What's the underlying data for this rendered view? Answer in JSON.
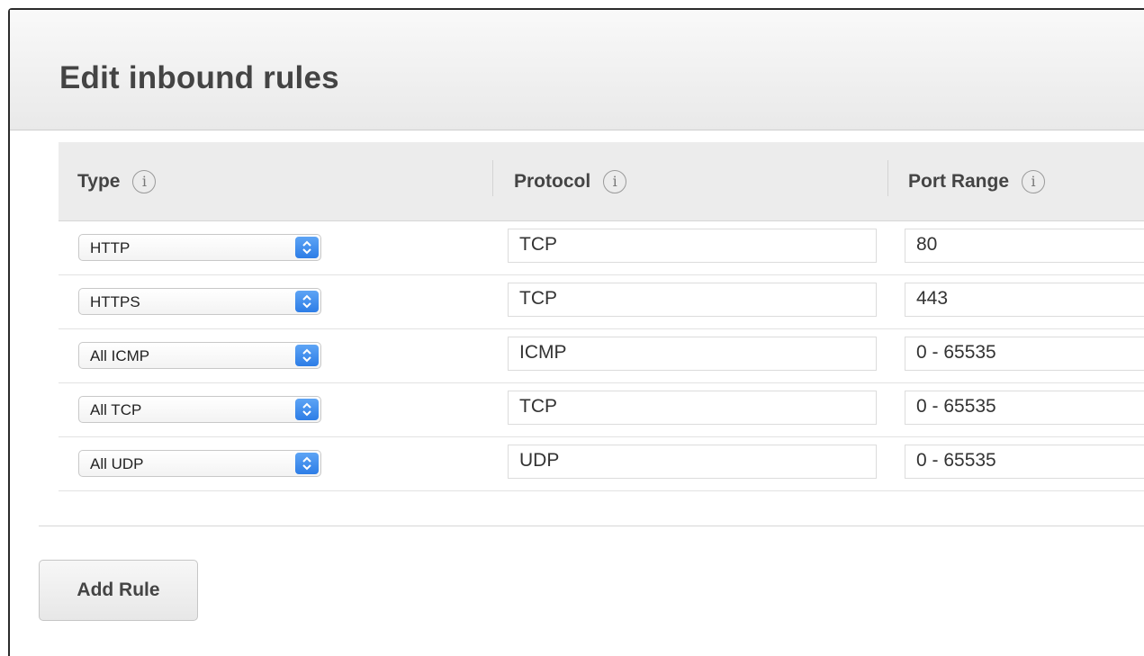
{
  "dialog": {
    "title": "Edit inbound rules",
    "add_rule_label": "Add Rule"
  },
  "table": {
    "columns": [
      {
        "label": "Type",
        "info_icon": "info-icon"
      },
      {
        "label": "Protocol",
        "info_icon": "info-icon"
      },
      {
        "label": "Port Range",
        "info_icon": "info-icon"
      }
    ],
    "rows": [
      {
        "type": "HTTP",
        "protocol": "TCP",
        "port_range": "80"
      },
      {
        "type": "HTTPS",
        "protocol": "TCP",
        "port_range": "443"
      },
      {
        "type": "All ICMP",
        "protocol": "ICMP",
        "port_range": "0 - 65535"
      },
      {
        "type": "All TCP",
        "protocol": "TCP",
        "port_range": "0 - 65535"
      },
      {
        "type": "All UDP",
        "protocol": "UDP",
        "port_range": "0 - 65535"
      }
    ]
  },
  "info_glyph": "i",
  "colors": {
    "select_arrow": "#2d7de6",
    "header_bg": "#ececec"
  }
}
